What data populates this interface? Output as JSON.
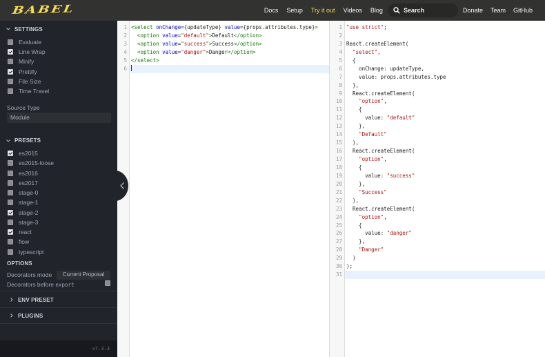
{
  "navbar": {
    "logo": "Babel",
    "links": [
      {
        "label": "Docs",
        "active": false
      },
      {
        "label": "Setup",
        "active": false
      },
      {
        "label": "Try it out",
        "active": true
      },
      {
        "label": "Videos",
        "active": false
      },
      {
        "label": "Blog",
        "active": false
      }
    ],
    "search_placeholder": "Search",
    "right_links": [
      "Donate",
      "Team",
      "GitHub"
    ]
  },
  "sidebar": {
    "settings": {
      "title": "SETTINGS",
      "items": [
        {
          "label": "Evaluate",
          "checked": false
        },
        {
          "label": "Line Wrap",
          "checked": true
        },
        {
          "label": "Minify",
          "checked": false
        },
        {
          "label": "Prettify",
          "checked": true
        },
        {
          "label": "File Size",
          "checked": false
        },
        {
          "label": "Time Travel",
          "checked": false
        }
      ]
    },
    "source_type": {
      "label": "Source Type",
      "value": "Module"
    },
    "presets": {
      "title": "PRESETS",
      "items": [
        {
          "label": "es2015",
          "checked": true
        },
        {
          "label": "es2015-loose",
          "checked": false
        },
        {
          "label": "es2016",
          "checked": false
        },
        {
          "label": "es2017",
          "checked": false
        },
        {
          "label": "stage-0",
          "checked": false
        },
        {
          "label": "stage-1",
          "checked": false
        },
        {
          "label": "stage-2",
          "checked": true
        },
        {
          "label": "stage-3",
          "checked": false
        },
        {
          "label": "react",
          "checked": true
        },
        {
          "label": "flow",
          "checked": false
        },
        {
          "label": "typescript",
          "checked": false
        }
      ]
    },
    "options": {
      "title": "OPTIONS",
      "decorators_mode_label": "Decorators mode",
      "decorators_mode_value": "Current Proposal",
      "decorators_before_label": "Decorators before",
      "decorators_before_code": "export",
      "decorators_before_checked": false
    },
    "env_preset_title": "ENV PRESET",
    "plugins_title": "PLUGINS",
    "version": "v7.3.3"
  },
  "editors": {
    "input": {
      "active_line": 6,
      "lines": [
        [
          [
            "t",
            "<select"
          ],
          [
            "p",
            " "
          ],
          [
            "a",
            "onChange"
          ],
          [
            "p",
            "={updateType} "
          ],
          [
            "a",
            "value"
          ],
          [
            "p",
            "={props.attributes.type}"
          ],
          [
            "t",
            ">"
          ]
        ],
        [
          [
            "p",
            "  "
          ],
          [
            "t",
            "<option"
          ],
          [
            "p",
            " "
          ],
          [
            "a",
            "value"
          ],
          [
            "p",
            "="
          ],
          [
            "s",
            "\"default\""
          ],
          [
            "t",
            ">"
          ],
          [
            "p",
            "Default"
          ],
          [
            "t",
            "</option>"
          ]
        ],
        [
          [
            "p",
            "  "
          ],
          [
            "t",
            "<option"
          ],
          [
            "p",
            " "
          ],
          [
            "a",
            "value"
          ],
          [
            "p",
            "="
          ],
          [
            "s",
            "\"success\""
          ],
          [
            "t",
            ">"
          ],
          [
            "p",
            "Success"
          ],
          [
            "t",
            "</option>"
          ]
        ],
        [
          [
            "p",
            "  "
          ],
          [
            "t",
            "<option"
          ],
          [
            "p",
            " "
          ],
          [
            "a",
            "value"
          ],
          [
            "p",
            "="
          ],
          [
            "s",
            "\"danger\""
          ],
          [
            "t",
            ">"
          ],
          [
            "p",
            "Danger"
          ],
          [
            "t",
            "</option>"
          ]
        ],
        [
          [
            "t",
            "</select>"
          ]
        ],
        []
      ]
    },
    "output": {
      "active_line": 31,
      "lines": [
        [
          [
            "s",
            "\"use strict\""
          ],
          [
            "p",
            ";"
          ]
        ],
        [],
        [
          [
            "p",
            "React.createElement("
          ]
        ],
        [
          [
            "p",
            "  "
          ],
          [
            "s",
            "\"select\""
          ],
          [
            "p",
            ","
          ]
        ],
        [
          [
            "p",
            "  {"
          ]
        ],
        [
          [
            "p",
            "    onChange: updateType,"
          ]
        ],
        [
          [
            "p",
            "    value: props.attributes.type"
          ]
        ],
        [
          [
            "p",
            "  },"
          ]
        ],
        [
          [
            "p",
            "  React.createElement("
          ]
        ],
        [
          [
            "p",
            "    "
          ],
          [
            "s",
            "\"option\""
          ],
          [
            "p",
            ","
          ]
        ],
        [
          [
            "p",
            "    {"
          ]
        ],
        [
          [
            "p",
            "      value: "
          ],
          [
            "s",
            "\"default\""
          ]
        ],
        [
          [
            "p",
            "    },"
          ]
        ],
        [
          [
            "p",
            "    "
          ],
          [
            "s",
            "\"Default\""
          ]
        ],
        [
          [
            "p",
            "  ),"
          ]
        ],
        [
          [
            "p",
            "  React.createElement("
          ]
        ],
        [
          [
            "p",
            "    "
          ],
          [
            "s",
            "\"option\""
          ],
          [
            "p",
            ","
          ]
        ],
        [
          [
            "p",
            "    {"
          ]
        ],
        [
          [
            "p",
            "      value: "
          ],
          [
            "s",
            "\"success\""
          ]
        ],
        [
          [
            "p",
            "    },"
          ]
        ],
        [
          [
            "p",
            "    "
          ],
          [
            "s",
            "\"Success\""
          ]
        ],
        [
          [
            "p",
            "  ),"
          ]
        ],
        [
          [
            "p",
            "  React.createElement("
          ]
        ],
        [
          [
            "p",
            "    "
          ],
          [
            "s",
            "\"option\""
          ],
          [
            "p",
            ","
          ]
        ],
        [
          [
            "p",
            "    {"
          ]
        ],
        [
          [
            "p",
            "      value: "
          ],
          [
            "s",
            "\"danger\""
          ]
        ],
        [
          [
            "p",
            "    },"
          ]
        ],
        [
          [
            "p",
            "    "
          ],
          [
            "s",
            "\"Danger\""
          ]
        ],
        [
          [
            "p",
            "  )"
          ]
        ],
        [
          [
            "p",
            ");"
          ]
        ],
        []
      ]
    }
  },
  "colors": {
    "accent_yellow": "#f5da55",
    "navbar_bg": "#323330",
    "sidebar_bg": "#21252b",
    "tag": "#117700",
    "attribute": "#0000cc",
    "string": "#aa1111",
    "active_line_bg": "#e8f2ff"
  }
}
